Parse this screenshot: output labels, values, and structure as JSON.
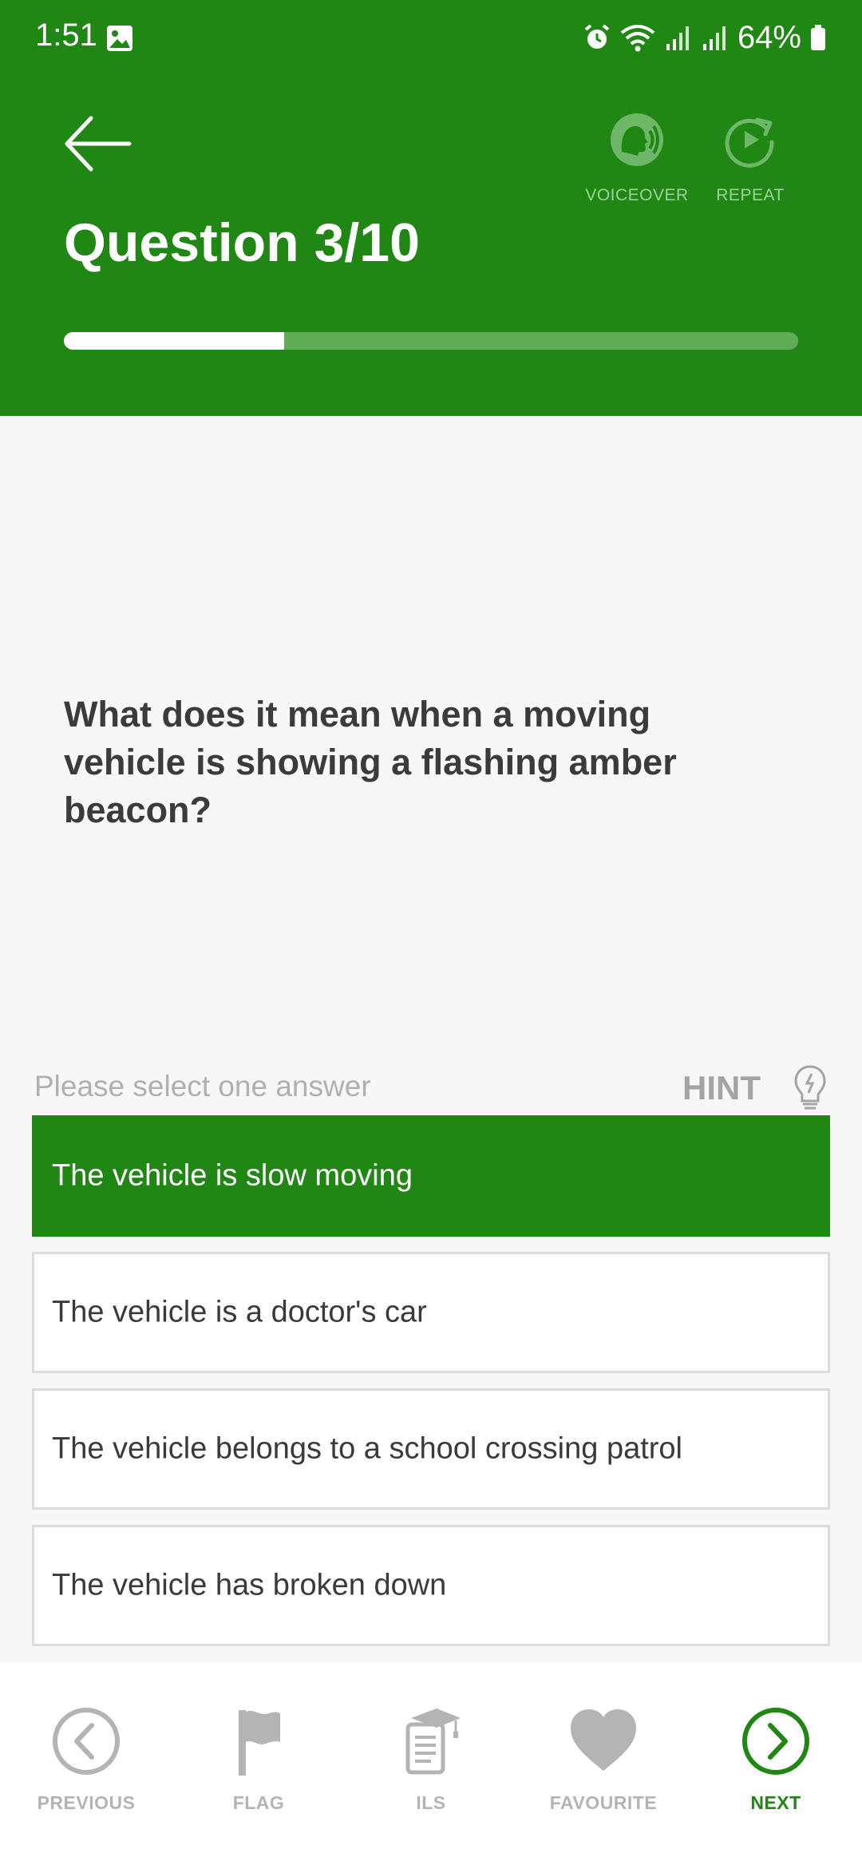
{
  "status_bar": {
    "time": "1:51",
    "battery": "64%"
  },
  "header": {
    "title": "Question 3/10",
    "progress": 0.3,
    "voiceover_label": "VOICEOVER",
    "repeat_label": "REPEAT"
  },
  "question": {
    "text": "What does it mean when a moving vehicle is showing a flashing amber beacon?"
  },
  "instruction": "Please select one answer",
  "hint_label": "HINT",
  "answers": [
    {
      "text": "The vehicle is slow moving",
      "selected": true
    },
    {
      "text": "The vehicle is a doctor's car",
      "selected": false
    },
    {
      "text": "The vehicle belongs to a school crossing patrol",
      "selected": false
    },
    {
      "text": "The vehicle has broken down",
      "selected": false
    }
  ],
  "bottom_nav": {
    "previous": "PREVIOUS",
    "flag": "FLAG",
    "ils": "ILS",
    "favourite": "FAVOURITE",
    "next": "NEXT"
  },
  "colors": {
    "brand_green": "#208714",
    "progress_track": "#5fae56",
    "inactive_gray": "#b4b4b4"
  },
  "icons": [
    "gallery-icon",
    "alarm-icon",
    "wifi-icon",
    "signal-icon",
    "battery-icon",
    "back-arrow-icon",
    "voiceover-icon",
    "repeat-icon",
    "lightbulb-icon",
    "chevron-left-icon",
    "flag-icon",
    "ils-icon",
    "heart-icon",
    "chevron-right-icon"
  ]
}
